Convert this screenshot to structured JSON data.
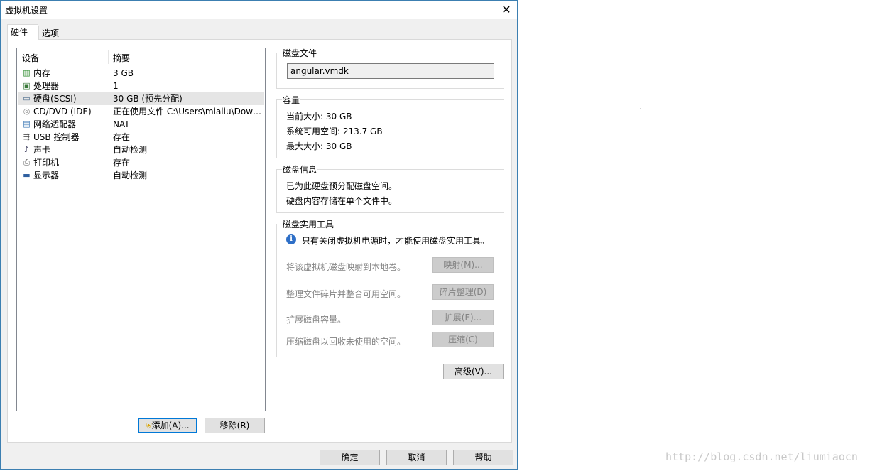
{
  "window": {
    "title": "虚拟机设置"
  },
  "tabs": [
    {
      "label": "硬件"
    },
    {
      "label": "选项"
    }
  ],
  "device_list": {
    "columns": [
      "设备",
      "摘要"
    ],
    "rows": [
      {
        "name": "内存",
        "summary": "3 GB",
        "icon": "memory-icon"
      },
      {
        "name": "处理器",
        "summary": "1",
        "icon": "processor-icon"
      },
      {
        "name": "硬盘(SCSI)",
        "summary": "30 GB (预先分配)",
        "icon": "hard-disk-icon",
        "selected": true
      },
      {
        "name": "CD/DVD (IDE)",
        "summary": "正在使用文件 C:\\Users\\mialiu\\Downl...",
        "icon": "cd-dvd-icon"
      },
      {
        "name": "网络适配器",
        "summary": "NAT",
        "icon": "network-adapter-icon"
      },
      {
        "name": "USB 控制器",
        "summary": "存在",
        "icon": "usb-icon"
      },
      {
        "name": "声卡",
        "summary": "自动检测",
        "icon": "sound-card-icon"
      },
      {
        "name": "打印机",
        "summary": "存在",
        "icon": "printer-icon"
      },
      {
        "name": "显示器",
        "summary": "自动检测",
        "icon": "display-icon"
      }
    ]
  },
  "list_buttons": {
    "add": "添加(A)...",
    "remove": "移除(R)"
  },
  "disk_file": {
    "title": "磁盘文件",
    "value": "angular.vmdk"
  },
  "capacity": {
    "title": "容量",
    "current": "当前大小: 30 GB",
    "available": "系统可用空间: 213.7 GB",
    "max": "最大大小: 30 GB"
  },
  "disk_info": {
    "title": "磁盘信息",
    "line1": "已为此硬盘预分配磁盘空间。",
    "line2": "硬盘内容存储在单个文件中。"
  },
  "disk_utilities": {
    "title": "磁盘实用工具",
    "notice": "只有关闭虚拟机电源时，才能使用磁盘实用工具。",
    "items": [
      {
        "label": "将该虚拟机磁盘映射到本地卷。",
        "button": "映射(M)..."
      },
      {
        "label": "整理文件碎片并整合可用空间。",
        "button": "碎片整理(D)"
      },
      {
        "label": "扩展磁盘容量。",
        "button": "扩展(E)..."
      },
      {
        "label": "压缩磁盘以回收未使用的空间。",
        "button": "压缩(C)"
      }
    ]
  },
  "advanced_button": "高级(V)...",
  "footer": {
    "ok": "确定",
    "cancel": "取消",
    "help": "帮助"
  },
  "watermark": "http://blog.csdn.net/liumiaocn",
  "colors": {
    "selected_row": "#e5e5e5",
    "dialog_bg": "#f0f0f0",
    "accent": "#0078d7"
  }
}
